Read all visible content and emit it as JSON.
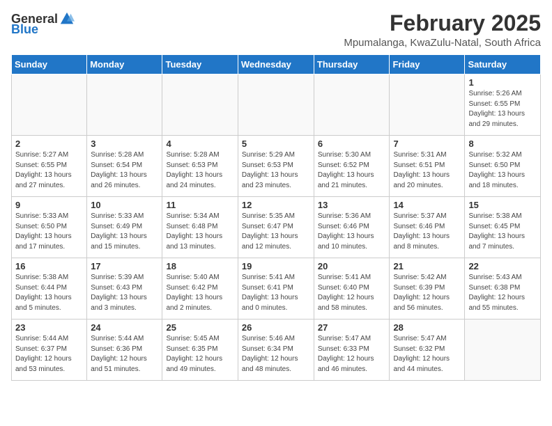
{
  "logo": {
    "general": "General",
    "blue": "Blue"
  },
  "title": "February 2025",
  "location": "Mpumalanga, KwaZulu-Natal, South Africa",
  "weekdays": [
    "Sunday",
    "Monday",
    "Tuesday",
    "Wednesday",
    "Thursday",
    "Friday",
    "Saturday"
  ],
  "weeks": [
    [
      {
        "day": "",
        "info": ""
      },
      {
        "day": "",
        "info": ""
      },
      {
        "day": "",
        "info": ""
      },
      {
        "day": "",
        "info": ""
      },
      {
        "day": "",
        "info": ""
      },
      {
        "day": "",
        "info": ""
      },
      {
        "day": "1",
        "info": "Sunrise: 5:26 AM\nSunset: 6:55 PM\nDaylight: 13 hours\nand 29 minutes."
      }
    ],
    [
      {
        "day": "2",
        "info": "Sunrise: 5:27 AM\nSunset: 6:55 PM\nDaylight: 13 hours\nand 27 minutes."
      },
      {
        "day": "3",
        "info": "Sunrise: 5:28 AM\nSunset: 6:54 PM\nDaylight: 13 hours\nand 26 minutes."
      },
      {
        "day": "4",
        "info": "Sunrise: 5:28 AM\nSunset: 6:53 PM\nDaylight: 13 hours\nand 24 minutes."
      },
      {
        "day": "5",
        "info": "Sunrise: 5:29 AM\nSunset: 6:53 PM\nDaylight: 13 hours\nand 23 minutes."
      },
      {
        "day": "6",
        "info": "Sunrise: 5:30 AM\nSunset: 6:52 PM\nDaylight: 13 hours\nand 21 minutes."
      },
      {
        "day": "7",
        "info": "Sunrise: 5:31 AM\nSunset: 6:51 PM\nDaylight: 13 hours\nand 20 minutes."
      },
      {
        "day": "8",
        "info": "Sunrise: 5:32 AM\nSunset: 6:50 PM\nDaylight: 13 hours\nand 18 minutes."
      }
    ],
    [
      {
        "day": "9",
        "info": "Sunrise: 5:33 AM\nSunset: 6:50 PM\nDaylight: 13 hours\nand 17 minutes."
      },
      {
        "day": "10",
        "info": "Sunrise: 5:33 AM\nSunset: 6:49 PM\nDaylight: 13 hours\nand 15 minutes."
      },
      {
        "day": "11",
        "info": "Sunrise: 5:34 AM\nSunset: 6:48 PM\nDaylight: 13 hours\nand 13 minutes."
      },
      {
        "day": "12",
        "info": "Sunrise: 5:35 AM\nSunset: 6:47 PM\nDaylight: 13 hours\nand 12 minutes."
      },
      {
        "day": "13",
        "info": "Sunrise: 5:36 AM\nSunset: 6:46 PM\nDaylight: 13 hours\nand 10 minutes."
      },
      {
        "day": "14",
        "info": "Sunrise: 5:37 AM\nSunset: 6:46 PM\nDaylight: 13 hours\nand 8 minutes."
      },
      {
        "day": "15",
        "info": "Sunrise: 5:38 AM\nSunset: 6:45 PM\nDaylight: 13 hours\nand 7 minutes."
      }
    ],
    [
      {
        "day": "16",
        "info": "Sunrise: 5:38 AM\nSunset: 6:44 PM\nDaylight: 13 hours\nand 5 minutes."
      },
      {
        "day": "17",
        "info": "Sunrise: 5:39 AM\nSunset: 6:43 PM\nDaylight: 13 hours\nand 3 minutes."
      },
      {
        "day": "18",
        "info": "Sunrise: 5:40 AM\nSunset: 6:42 PM\nDaylight: 13 hours\nand 2 minutes."
      },
      {
        "day": "19",
        "info": "Sunrise: 5:41 AM\nSunset: 6:41 PM\nDaylight: 13 hours\nand 0 minutes."
      },
      {
        "day": "20",
        "info": "Sunrise: 5:41 AM\nSunset: 6:40 PM\nDaylight: 12 hours\nand 58 minutes."
      },
      {
        "day": "21",
        "info": "Sunrise: 5:42 AM\nSunset: 6:39 PM\nDaylight: 12 hours\nand 56 minutes."
      },
      {
        "day": "22",
        "info": "Sunrise: 5:43 AM\nSunset: 6:38 PM\nDaylight: 12 hours\nand 55 minutes."
      }
    ],
    [
      {
        "day": "23",
        "info": "Sunrise: 5:44 AM\nSunset: 6:37 PM\nDaylight: 12 hours\nand 53 minutes."
      },
      {
        "day": "24",
        "info": "Sunrise: 5:44 AM\nSunset: 6:36 PM\nDaylight: 12 hours\nand 51 minutes."
      },
      {
        "day": "25",
        "info": "Sunrise: 5:45 AM\nSunset: 6:35 PM\nDaylight: 12 hours\nand 49 minutes."
      },
      {
        "day": "26",
        "info": "Sunrise: 5:46 AM\nSunset: 6:34 PM\nDaylight: 12 hours\nand 48 minutes."
      },
      {
        "day": "27",
        "info": "Sunrise: 5:47 AM\nSunset: 6:33 PM\nDaylight: 12 hours\nand 46 minutes."
      },
      {
        "day": "28",
        "info": "Sunrise: 5:47 AM\nSunset: 6:32 PM\nDaylight: 12 hours\nand 44 minutes."
      },
      {
        "day": "",
        "info": ""
      }
    ]
  ]
}
